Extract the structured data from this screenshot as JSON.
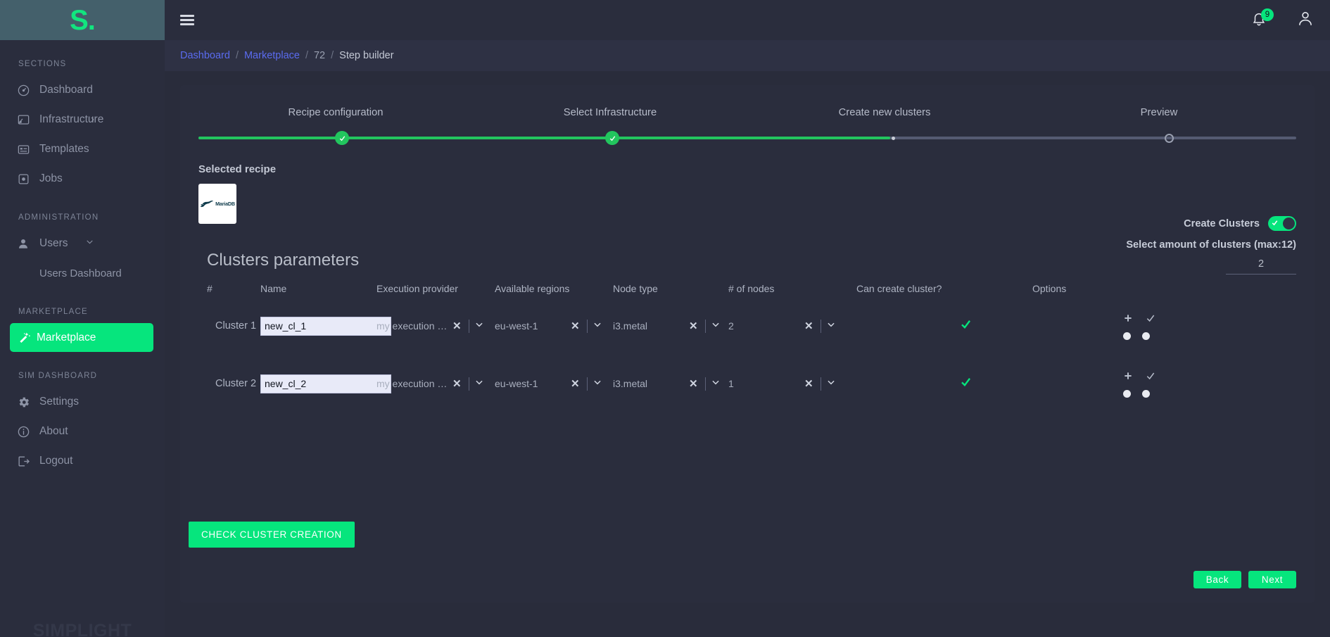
{
  "sidebar": {
    "logo": "S.",
    "watermark": "SIMPLIGHT",
    "groups": [
      {
        "label": "SECTIONS",
        "items": [
          {
            "label": "Dashboard",
            "icon": "gauge-icon",
            "chevron": ""
          },
          {
            "label": "Infrastructure",
            "icon": "server-icon",
            "chevron": "›"
          },
          {
            "label": "Templates",
            "icon": "template-icon",
            "chevron": ""
          },
          {
            "label": "Jobs",
            "icon": "jobs-icon",
            "chevron": ""
          }
        ]
      },
      {
        "label": "ADMINISTRATION",
        "items": [
          {
            "label": "Users",
            "icon": "user-icon",
            "chevron": "⌄"
          },
          {
            "label": "Users Dashboard",
            "icon": "",
            "chevron": ""
          }
        ]
      },
      {
        "label": "MARKETPLACE",
        "items": [
          {
            "label": "Marketplace",
            "icon": "wand-icon",
            "chevron": "",
            "active": true
          }
        ]
      },
      {
        "label": "SIM DASHBOARD",
        "items": [
          {
            "label": "Settings",
            "icon": "gear-icon",
            "chevron": ""
          },
          {
            "label": "About",
            "icon": "info-icon",
            "chevron": ""
          },
          {
            "label": "Logout",
            "icon": "logout-icon",
            "chevron": ""
          }
        ]
      }
    ]
  },
  "topbar": {
    "menu_icon": "hamburger-icon",
    "notification_count": "9",
    "account_icon": "user-avatar-icon"
  },
  "breadcrumb": {
    "items": [
      {
        "text": "Dashboard",
        "type": "link"
      },
      {
        "text": "Marketplace",
        "type": "link"
      },
      {
        "text": "72",
        "type": "plain"
      },
      {
        "text": "Step builder",
        "type": "current"
      }
    ],
    "separator": "/"
  },
  "stepper": {
    "steps": [
      {
        "label": "Recipe configuration",
        "state": "done"
      },
      {
        "label": "Select Infrastructure",
        "state": "done"
      },
      {
        "label": "Create new clusters",
        "state": "current"
      },
      {
        "label": "Preview",
        "state": "pending"
      }
    ],
    "progress_percent": 63
  },
  "recipe": {
    "title": "Selected recipe",
    "name": "MariaDB"
  },
  "create_clusters": {
    "label": "Create Clusters",
    "enabled": true,
    "amount_label": "Select amount of clusters (max:12)",
    "amount_value": "2"
  },
  "clusters": {
    "section_title": "Clusters parameters",
    "headers": [
      "#",
      "Name",
      "Execution provider",
      "Available regions",
      "Node type",
      "# of nodes",
      "Can create cluster?",
      "Options"
    ],
    "rows": [
      {
        "index": "Cluster 1",
        "name": "new_cl_1",
        "provider": "my execution …",
        "region": "eu-west-1",
        "node_type": "i3.metal",
        "nodes": "2",
        "can_create": true
      },
      {
        "index": "Cluster 2",
        "name": "new_cl_2",
        "provider": "my execution …",
        "region": "eu-west-1",
        "node_type": "i3.metal",
        "nodes": "1",
        "can_create": true
      }
    ]
  },
  "buttons": {
    "check_cluster_creation": "CHECK CLUSTER CREATION",
    "back": "Back",
    "next": "Next"
  },
  "colors": {
    "accent_green": "#06e57d",
    "progress_green": "#22c55e",
    "link_blue": "#5a6bef",
    "panel": "#2a2d3d",
    "page": "#292c3b"
  }
}
